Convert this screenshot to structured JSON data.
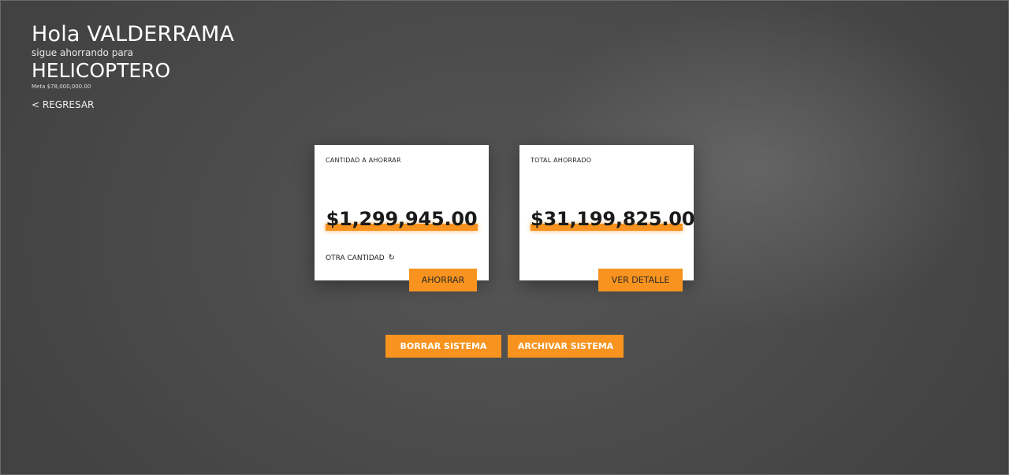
{
  "header": {
    "greeting": "Hola VALDERRAMA",
    "subtitle": "sigue ahorrando para",
    "goal_name": "HELICOPTERO",
    "goal_meta": "Meta $78,000,000.00",
    "back_label": "< REGRESAR"
  },
  "cards": {
    "save": {
      "label": "CANTIDAD A AHORRAR",
      "amount": "$1,299,945.00",
      "other_label": "OTRA CANTIDAD",
      "other_icon": "refresh-icon",
      "button_label": "AHORRAR"
    },
    "total": {
      "label": "TOTAL AHORRADO",
      "amount": "$31,199,825.00",
      "button_label": "VER DETALLE"
    }
  },
  "actions": {
    "delete_label": "BORRAR SISTEMA",
    "archive_label": "ARCHIVAR SISTEMA"
  },
  "colors": {
    "accent": "#f7931e",
    "background": "#4a4a4a",
    "card": "#ffffff"
  }
}
